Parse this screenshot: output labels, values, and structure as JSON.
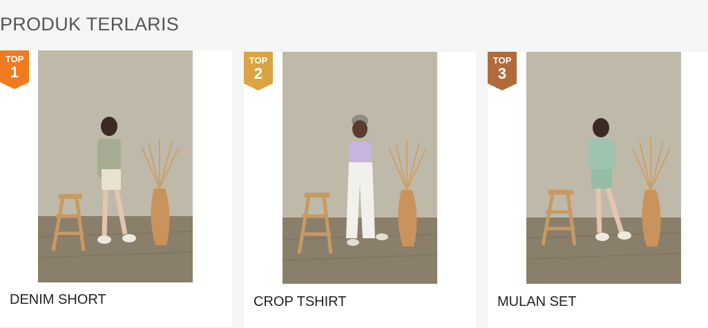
{
  "section": {
    "title": "PRODUK TERLARIS"
  },
  "products": [
    {
      "rank_label": "TOP",
      "rank": "1",
      "name": "DENIM SHORT",
      "badge_color": "#f07a1e",
      "outfit": "sage jacket, cream shorts"
    },
    {
      "rank_label": "TOP",
      "rank": "2",
      "name": "CROP TSHIRT",
      "badge_color": "#d9a441",
      "outfit": "lilac crop top, white pants"
    },
    {
      "rank_label": "TOP",
      "rank": "3",
      "name": "MULAN SET",
      "badge_color": "#b06a3b",
      "outfit": "mint sweatshirt set"
    }
  ]
}
